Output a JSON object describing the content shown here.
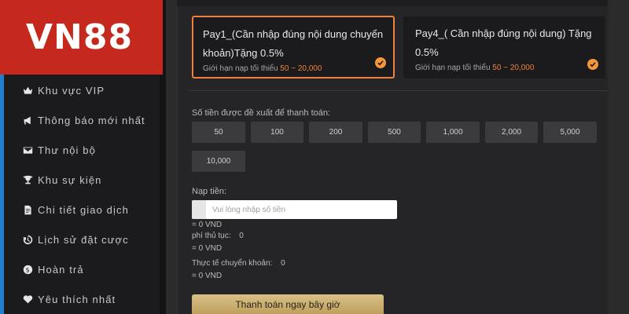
{
  "brand": {
    "logo_text": "VN88",
    "logo_color": "#c5281c",
    "accent": "#f0813a"
  },
  "sidebar": {
    "items": [
      {
        "label": "Khu vực VIP",
        "icon": "crown-icon"
      },
      {
        "label": "Thông báo mới nhất",
        "icon": "megaphone-icon"
      },
      {
        "label": "Thư nội bộ",
        "icon": "mail-icon"
      },
      {
        "label": "Khu sự kiện",
        "icon": "trophy-icon"
      },
      {
        "label": "Chi tiết giao dịch",
        "icon": "document-icon"
      },
      {
        "label": "Lịch sử đặt cược",
        "icon": "history-icon"
      },
      {
        "label": "Hoàn trả",
        "icon": "dollar-circle-icon"
      },
      {
        "label": "Yêu thích nhất",
        "icon": "heart-icon"
      }
    ]
  },
  "payment_methods": [
    {
      "title": "Pay1_(Cần nhập đúng nội dung chuyển khoản)Tặng 0.5%",
      "limit_label": "Giới hạn nạp tối thiểu",
      "limit_range": "50 ~ 20,000",
      "selected": true
    },
    {
      "title": "Pay4_( Cần nhập đúng nội dung) Tặng 0.5%",
      "limit_label": "Giới hạn nạp tối thiểu",
      "limit_range": "50 ~ 20,000",
      "selected": false
    }
  ],
  "suggested": {
    "label": "Số tiền được đề xuất để thanh toán:",
    "amounts": [
      "50",
      "100",
      "200",
      "500",
      "1,000",
      "2,000",
      "5,000",
      "10,000"
    ]
  },
  "deposit": {
    "label": "Nạp tiền:",
    "placeholder": "Vui lòng nhập số tiền",
    "value": "",
    "vnd_equiv": "= 0 VND",
    "fee_label": "phí thủ tục:",
    "fee_value": "0",
    "fee_vnd": "= 0 VND",
    "actual_label": "Thực tế chuyển khoản:",
    "actual_value": "0",
    "actual_vnd": "= 0 VND"
  },
  "submit_label": "Thanh toán ngay bây giờ"
}
